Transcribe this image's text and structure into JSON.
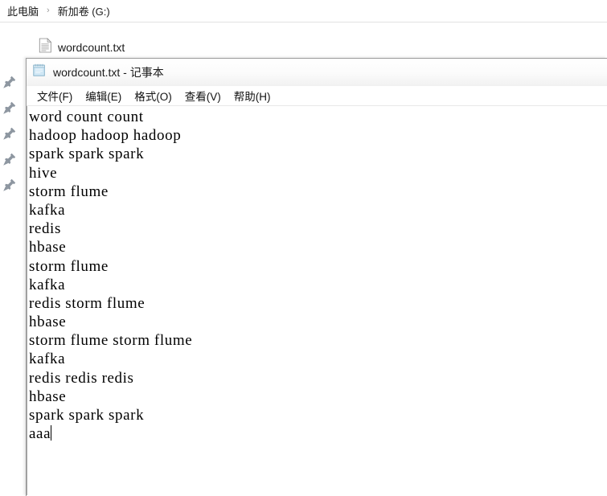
{
  "explorer": {
    "breadcrumb": {
      "items": [
        {
          "label": "此电脑",
          "icon": "computer-icon"
        },
        {
          "label": "新加卷 (G:)",
          "icon": "drive-icon"
        }
      ],
      "separator": "›"
    },
    "nav_pane": {
      "pins": [
        {
          "icon": "pushpin-icon"
        },
        {
          "icon": "pushpin-icon"
        },
        {
          "icon": "pushpin-icon"
        },
        {
          "icon": "pushpin-icon"
        },
        {
          "icon": "pushpin-icon"
        }
      ]
    },
    "file_list": {
      "items": [
        {
          "name": "wordcount.txt",
          "icon": "text-file-icon"
        }
      ]
    }
  },
  "notepad": {
    "window_icon": "notepad-icon",
    "title": "wordcount.txt - 记事本",
    "menu": [
      {
        "label": "文件(F)"
      },
      {
        "label": "编辑(E)"
      },
      {
        "label": "格式(O)"
      },
      {
        "label": "查看(V)"
      },
      {
        "label": "帮助(H)"
      }
    ],
    "document": {
      "lines": [
        "word count count",
        "hadoop hadoop hadoop",
        "spark spark spark",
        "hive",
        "storm flume",
        "kafka",
        "redis",
        "hbase",
        "storm flume",
        "kafka",
        "redis storm flume",
        "hbase",
        "storm flume storm flume",
        "kafka",
        "redis redis redis",
        "hbase",
        "spark spark spark",
        "aaa"
      ],
      "caret_line_index": 17,
      "caret_visible": true
    }
  },
  "colors": {
    "window_bg": "#ffffff",
    "text": "#000000",
    "breadcrumb_text": "#1b1b1b",
    "separator": "#9a9a9a",
    "border": "#9b9b9b",
    "pin": "#8d96a0",
    "notepad_icon": "#bfe0f0"
  }
}
